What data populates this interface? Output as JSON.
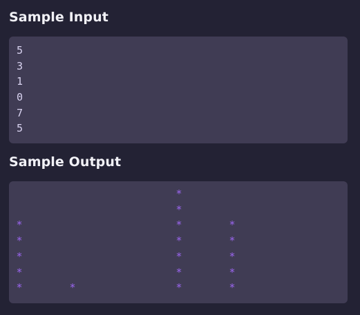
{
  "sample_input": {
    "title": "Sample Input",
    "lines": [
      "5",
      "3",
      "1",
      "0",
      "7",
      "5"
    ]
  },
  "sample_output": {
    "title": "Sample Output",
    "star_char": "*",
    "star_color": "#9b66f0",
    "column_heights": [
      5,
      1,
      0,
      7,
      5
    ]
  },
  "colors": {
    "background": "#232234",
    "box": "#403c54",
    "title": "#f1f1f6",
    "input_text": "#d9d3f0"
  }
}
